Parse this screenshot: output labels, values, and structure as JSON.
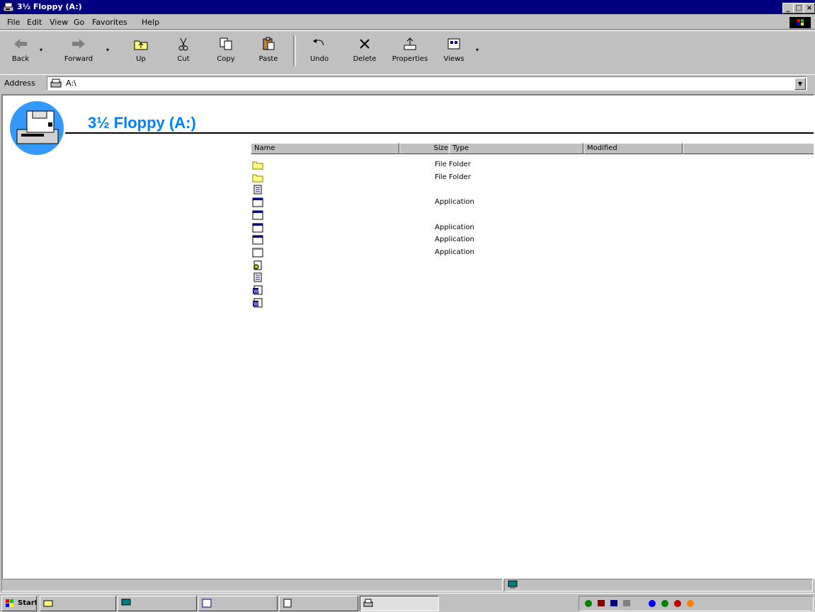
{
  "window": {
    "title": "3½ Floppy (A:)"
  },
  "title_buttons": {
    "minimize": "_",
    "maximize": "□",
    "close": "×"
  },
  "menu": [
    "File",
    "Edit",
    "View",
    "Go",
    "Favorites",
    "Help"
  ],
  "toolbar": {
    "back": "Back",
    "forward": "Forward",
    "up": "Up",
    "cut": "Cut",
    "copy": "Copy",
    "paste": "Paste",
    "undo": "Undo",
    "delete": "Delete",
    "properties": "Properties",
    "views": "Views"
  },
  "address": {
    "label": "Address",
    "value": "A:\\"
  },
  "folder": {
    "title": "3½ Floppy (A:)",
    "info": [
      "",
      "",
      "",
      "",
      ""
    ]
  },
  "columns": {
    "name": "Name",
    "size": "Size",
    "type": "Type",
    "modified": "Modified"
  },
  "files": [
    {
      "icon": "folder",
      "name": "",
      "size": "",
      "type": "File Folder",
      "modified": ""
    },
    {
      "icon": "folder",
      "name": "",
      "size": "",
      "type": "File Folder",
      "modified": ""
    },
    {
      "icon": "document",
      "name": "",
      "size": "",
      "type": "",
      "modified": ""
    },
    {
      "icon": "application",
      "name": "",
      "size": "",
      "type": "Application",
      "modified": ""
    },
    {
      "icon": "application",
      "name": "",
      "size": "",
      "type": "",
      "modified": ""
    },
    {
      "icon": "application",
      "name": "",
      "size": "",
      "type": "Application",
      "modified": ""
    },
    {
      "icon": "application",
      "name": "",
      "size": "",
      "type": "Application",
      "modified": ""
    },
    {
      "icon": "application-white",
      "name": "",
      "size": "",
      "type": "Application",
      "modified": ""
    },
    {
      "icon": "settings",
      "name": "",
      "size": "",
      "type": "",
      "modified": ""
    },
    {
      "icon": "document",
      "name": "",
      "size": "",
      "type": "",
      "modified": ""
    },
    {
      "icon": "word-document",
      "name": "",
      "size": "",
      "type": "",
      "modified": ""
    },
    {
      "icon": "word-document",
      "name": "",
      "size": "",
      "type": "",
      "modified": ""
    }
  ],
  "status": {
    "size": "",
    "location": ""
  },
  "taskbar": {
    "start": "Start",
    "tasks": [
      "",
      "",
      "",
      "",
      ""
    ],
    "clock": ""
  },
  "colors": {
    "titlebar": "#000080",
    "folder_title": "#0080ff",
    "window": "#c0c0c0"
  }
}
